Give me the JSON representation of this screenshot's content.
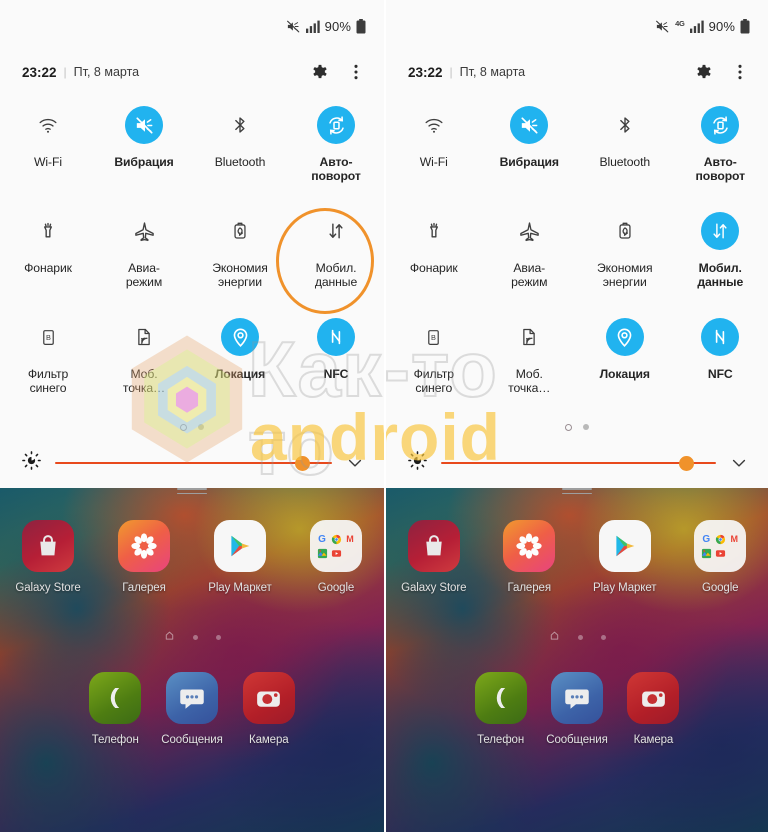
{
  "panels": [
    {
      "id": "left",
      "status": {
        "mute_icon": "mute-icon",
        "show_4g": false,
        "network_label": "",
        "signal_icon": "signal-bars-icon",
        "battery_percent": "90%",
        "battery_icon": "battery-icon"
      },
      "header": {
        "time": "23:22",
        "divider": "|",
        "date": "Пт, 8 марта",
        "settings_icon": "gear-icon",
        "overflow_icon": "more-vertical-icon"
      },
      "toggles": [
        [
          {
            "label": "Wi-Fi",
            "icon": "wifi-icon",
            "on": false
          },
          {
            "label": "Вибрация",
            "icon": "vibrate-icon",
            "on": true
          },
          {
            "label": "Bluetooth",
            "icon": "bluetooth-icon",
            "on": false
          },
          {
            "label": "Авто-\nповорот",
            "icon": "auto-rotate-icon",
            "on": true
          }
        ],
        [
          {
            "label": "Фонарик",
            "icon": "flashlight-icon",
            "on": false
          },
          {
            "label": "Авиа-\nрежим",
            "icon": "airplane-icon",
            "on": false
          },
          {
            "label": "Экономия\nэнергии",
            "icon": "power-saving-icon",
            "on": false
          },
          {
            "label": "Мобил.\nданные",
            "icon": "mobile-data-icon",
            "on": false,
            "highlighted": true
          }
        ],
        [
          {
            "label": "Фильтр\nсинего",
            "icon": "blue-light-filter-icon",
            "on": false
          },
          {
            "label": "Моб.\nточка…",
            "icon": "mobile-hotspot-icon",
            "on": false
          },
          {
            "label": "Локация",
            "icon": "location-icon",
            "on": true
          },
          {
            "label": "NFC",
            "icon": "nfc-icon",
            "on": true
          }
        ]
      ],
      "page_dots": {
        "count": 2,
        "active_index": 0
      },
      "brightness": {
        "icon": "brightness-icon",
        "value_percent": 92,
        "track_color": "#E8491C",
        "thumb_color": "#F0922B",
        "expand_icon": "chevron-down-icon"
      },
      "home": {
        "apps": [
          {
            "label": "Galaxy Store",
            "icon": "galaxy-store-icon"
          },
          {
            "label": "Галерея",
            "icon": "gallery-icon"
          },
          {
            "label": "Play Маркет",
            "icon": "play-store-icon"
          },
          {
            "label": "Google",
            "icon": "google-folder-icon"
          }
        ],
        "page_dots": {
          "count": 3,
          "active_index": 0,
          "home_icon": "home-icon"
        },
        "dock": [
          {
            "label": "Телефон",
            "icon": "phone-icon"
          },
          {
            "label": "Сообщения",
            "icon": "messages-icon"
          },
          {
            "label": "Камера",
            "icon": "camera-icon"
          }
        ]
      }
    },
    {
      "id": "right",
      "status": {
        "mute_icon": "mute-icon",
        "show_4g": true,
        "network_label": "4G",
        "signal_icon": "signal-bars-icon",
        "battery_percent": "90%",
        "battery_icon": "battery-icon"
      },
      "header": {
        "time": "23:22",
        "divider": "|",
        "date": "Пт, 8 марта",
        "settings_icon": "gear-icon",
        "overflow_icon": "more-vertical-icon"
      },
      "toggles": [
        [
          {
            "label": "Wi-Fi",
            "icon": "wifi-icon",
            "on": false
          },
          {
            "label": "Вибрация",
            "icon": "vibrate-icon",
            "on": true
          },
          {
            "label": "Bluetooth",
            "icon": "bluetooth-icon",
            "on": false
          },
          {
            "label": "Авто-\nповорот",
            "icon": "auto-rotate-icon",
            "on": true
          }
        ],
        [
          {
            "label": "Фонарик",
            "icon": "flashlight-icon",
            "on": false
          },
          {
            "label": "Авиа-\nрежим",
            "icon": "airplane-icon",
            "on": false
          },
          {
            "label": "Экономия\nэнергии",
            "icon": "power-saving-icon",
            "on": false
          },
          {
            "label": "Мобил.\nданные",
            "icon": "mobile-data-icon",
            "on": true
          }
        ],
        [
          {
            "label": "Фильтр\nсинего",
            "icon": "blue-light-filter-icon",
            "on": false
          },
          {
            "label": "Моб.\nточка…",
            "icon": "mobile-hotspot-icon",
            "on": false
          },
          {
            "label": "Локация",
            "icon": "location-icon",
            "on": true
          },
          {
            "label": "NFC",
            "icon": "nfc-icon",
            "on": true
          }
        ]
      ],
      "page_dots": {
        "count": 2,
        "active_index": 0
      },
      "brightness": {
        "icon": "brightness-icon",
        "value_percent": 92,
        "track_color": "#E8491C",
        "thumb_color": "#F0922B",
        "expand_icon": "chevron-down-icon"
      },
      "home": {
        "apps": [
          {
            "label": "Galaxy Store",
            "icon": "galaxy-store-icon"
          },
          {
            "label": "Галерея",
            "icon": "gallery-icon"
          },
          {
            "label": "Play Маркет",
            "icon": "play-store-icon"
          },
          {
            "label": "Google",
            "icon": "google-folder-icon"
          }
        ],
        "page_dots": {
          "count": 3,
          "active_index": 0,
          "home_icon": "home-icon"
        },
        "dock": [
          {
            "label": "Телефон",
            "icon": "phone-icon"
          },
          {
            "label": "Сообщения",
            "icon": "messages-icon"
          },
          {
            "label": "Камера",
            "icon": "camera-icon"
          }
        ]
      }
    }
  ],
  "watermark": {
    "text_outline": "Как-то",
    "text_solid": "android",
    "logo_icon": "polygon-logo-icon"
  },
  "colors": {
    "toggle_on": "#21B3EF",
    "toggle_off": "#4a4a4a",
    "highlight_ring": "#F0922B",
    "slider_track": "#E8491C",
    "slider_thumb": "#F0922B"
  }
}
